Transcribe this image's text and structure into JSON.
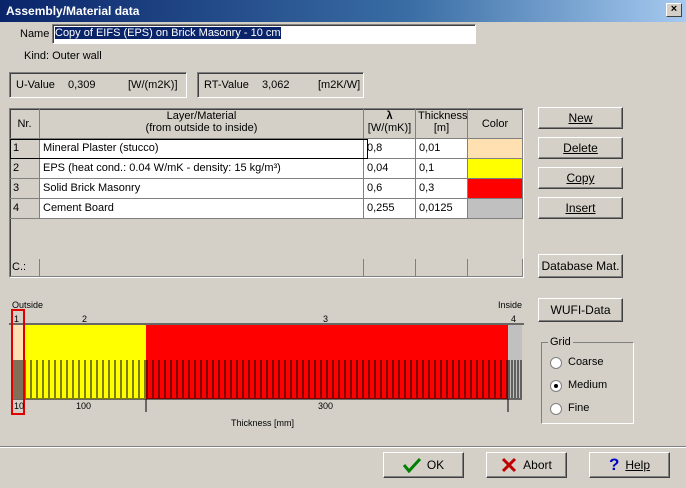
{
  "window": {
    "title": "Assembly/Material data",
    "close": "×"
  },
  "name_label": "Name",
  "name_value": "Copy of EIFS (EPS) on Brick Masonry - 10 cm",
  "kind": "Kind: Outer wall",
  "u_value": {
    "label": "U-Value",
    "value": "0,309",
    "unit": "[W/(m2K)]"
  },
  "rt_value": {
    "label": "RT-Value",
    "value": "3,062",
    "unit": "[m2K/W]"
  },
  "table": {
    "headers": {
      "nr": "Nr.",
      "layer": "Layer/Material",
      "layer_sub": "(from outside to inside)",
      "lambda": "λ",
      "lambda_unit": "[W/(mK)]",
      "thickness": "Thickness",
      "thickness_unit": "[m]",
      "color": "Color"
    },
    "rows": [
      {
        "nr": "1",
        "material": "Mineral Plaster (stucco)",
        "lambda": "0,8",
        "thickness": "0,01",
        "color": "#ffe0b0"
      },
      {
        "nr": "2",
        "material": "EPS (heat cond.: 0.04 W/mK - density: 15 kg/m³)",
        "lambda": "0,04",
        "thickness": "0,1",
        "color": "#ffff00"
      },
      {
        "nr": "3",
        "material": "Solid Brick Masonry",
        "lambda": "0,6",
        "thickness": "0,3",
        "color": "#ff0000"
      },
      {
        "nr": "4",
        "material": "Cement Board",
        "lambda": "0,255",
        "thickness": "0,0125",
        "color": "#c0c0c0"
      }
    ],
    "footer_label": "C.:"
  },
  "buttons": {
    "new": "New",
    "delete": "Delete",
    "copy": "Copy",
    "insert": "Insert",
    "database": "Database Mat.",
    "wufi": "WUFI-Data",
    "ok": "OK",
    "abort": "Abort",
    "help": "Help"
  },
  "diagram": {
    "outside_label": "Outside",
    "inside_label": "Inside",
    "layer_numbers": [
      "1",
      "2",
      "3",
      "4"
    ],
    "scale_labels": [
      "10",
      "100",
      "300"
    ],
    "axis_label": "Thickness [mm]"
  },
  "grid": {
    "title": "Grid",
    "options": [
      "Coarse",
      "Medium",
      "Fine"
    ],
    "selected": "Medium"
  },
  "icons": {
    "ok": "check-icon",
    "abort": "x-icon",
    "help": "question-icon"
  },
  "colors": {
    "title_bar": "#0a246a",
    "plaster": "#ffe0b0",
    "eps": "#ffff00",
    "brick": "#ff0000",
    "board": "#c0c0c0",
    "highlight": "#e00000"
  }
}
